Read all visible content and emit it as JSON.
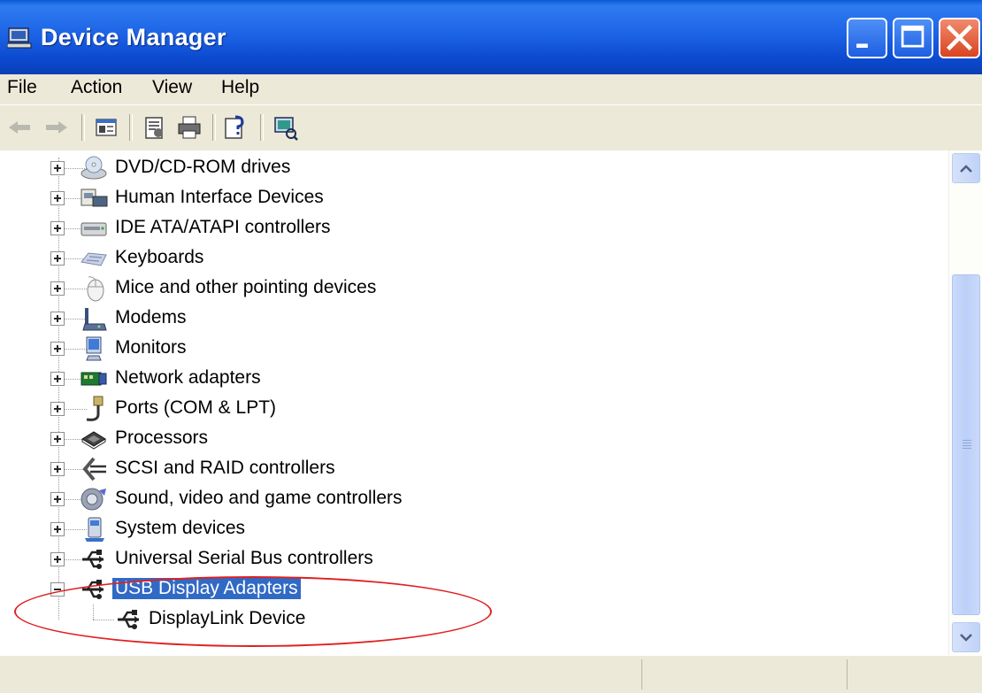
{
  "window": {
    "title": "Device Manager",
    "icon": "computer-icon",
    "controls": [
      "minimize-icon",
      "maximize-icon",
      "close-icon"
    ]
  },
  "menu": {
    "items": [
      "File",
      "Action",
      "View",
      "Help"
    ]
  },
  "toolbar": {
    "buttons": [
      "back-icon",
      "forward-icon",
      "properties-view-icon",
      "properties-icon",
      "print-icon",
      "help-icon",
      "scan-hardware-icon"
    ]
  },
  "tree": {
    "categories": [
      {
        "label": "DVD/CD-ROM drives",
        "icon": "dvd-drive-icon",
        "expanded": false
      },
      {
        "label": "Human Interface Devices",
        "icon": "hid-icon",
        "expanded": false
      },
      {
        "label": "IDE ATA/ATAPI controllers",
        "icon": "ide-controller-icon",
        "expanded": false
      },
      {
        "label": "Keyboards",
        "icon": "keyboard-icon",
        "expanded": false
      },
      {
        "label": "Mice and other pointing devices",
        "icon": "mouse-icon",
        "expanded": false
      },
      {
        "label": "Modems",
        "icon": "modem-icon",
        "expanded": false
      },
      {
        "label": "Monitors",
        "icon": "monitor-icon",
        "expanded": false
      },
      {
        "label": "Network adapters",
        "icon": "network-adapter-icon",
        "expanded": false
      },
      {
        "label": "Ports (COM & LPT)",
        "icon": "port-icon",
        "expanded": false
      },
      {
        "label": "Processors",
        "icon": "processor-icon",
        "expanded": false
      },
      {
        "label": "SCSI and RAID controllers",
        "icon": "scsi-icon",
        "expanded": false
      },
      {
        "label": "Sound, video and game controllers",
        "icon": "sound-icon",
        "expanded": false
      },
      {
        "label": "System devices",
        "icon": "system-icon",
        "expanded": false
      },
      {
        "label": "Universal Serial Bus controllers",
        "icon": "usb-icon",
        "expanded": false
      },
      {
        "label": "USB Display Adapters",
        "icon": "usb-icon",
        "expanded": true,
        "selected": true
      }
    ],
    "children": [
      {
        "label": "DisplayLink Device",
        "icon": "usb-icon"
      }
    ]
  },
  "colors": {
    "titlebar": "#0a5ad7",
    "selection": "#316ac5",
    "highlight_ellipse": "#e02020",
    "chrome": "#ece9d8"
  }
}
